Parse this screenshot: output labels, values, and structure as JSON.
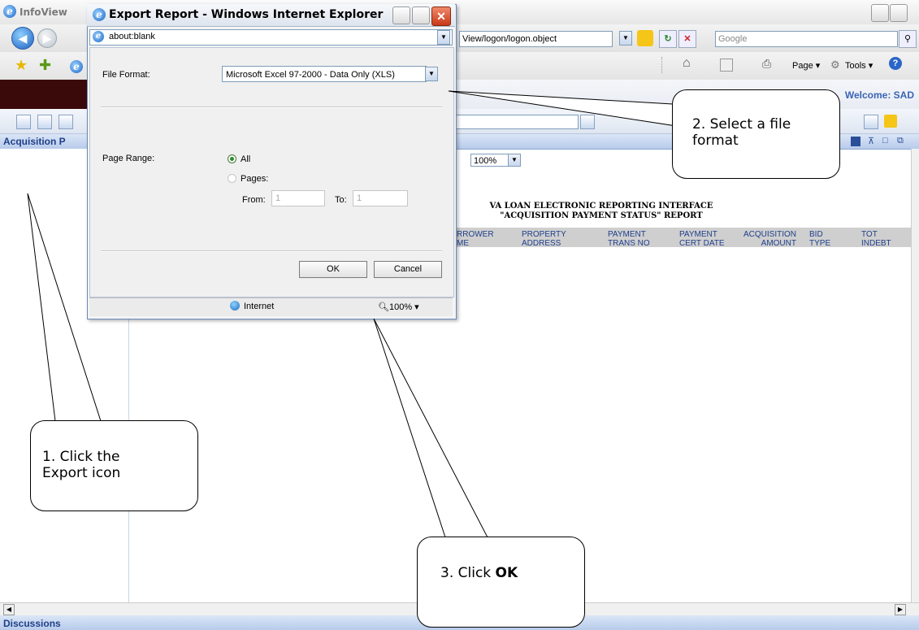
{
  "main_window": {
    "title": "InfoView",
    "address_text": "View/logon/logon.object",
    "search_placeholder": "Google",
    "commands": {
      "page": "Page",
      "tools": "Tools"
    },
    "welcome": "Welcome: SAD"
  },
  "panel": {
    "title": "Acquisition P",
    "zoom": "100%",
    "report_title_line1": "VA LOAN ELECTRONIC REPORTING INTERFACE",
    "report_title_line2": "\"ACQUISITION PAYMENT STATUS\" REPORT",
    "columns": [
      {
        "l1": "RROWER",
        "l2": "ME"
      },
      {
        "l1": "PROPERTY",
        "l2": "ADDRESS"
      },
      {
        "l1": "PAYMENT",
        "l2": "TRANS NO"
      },
      {
        "l1": "PAYMENT",
        "l2": "CERT DATE"
      },
      {
        "l1": "ACQUISITION",
        "l2": "AMOUNT"
      },
      {
        "l1": "BID",
        "l2": "TYPE"
      },
      {
        "l1": "TOT",
        "l2": "INDEBT"
      }
    ]
  },
  "bottom": {
    "discussions": "Discussions"
  },
  "dialog": {
    "title": "Export Report - Windows Internet Explorer",
    "address": "about:blank",
    "file_format_label": "File Format:",
    "file_format_value": "Microsoft Excel 97-2000 - Data Only (XLS)",
    "page_range_label": "Page Range:",
    "all_label": "All",
    "pages_label": "Pages:",
    "from_label": "From:",
    "from_value": "1",
    "to_label": "To:",
    "to_value": "1",
    "ok": "OK",
    "cancel": "Cancel",
    "status_zone": "Internet",
    "status_zoom": "100%"
  },
  "callouts": {
    "c1_line1": "1. Click the",
    "c1_line2": "Export icon",
    "c2_line1": "2. Select a file",
    "c2_line2": "format",
    "c3_prefix": "3. Click ",
    "c3_bold": "OK"
  }
}
